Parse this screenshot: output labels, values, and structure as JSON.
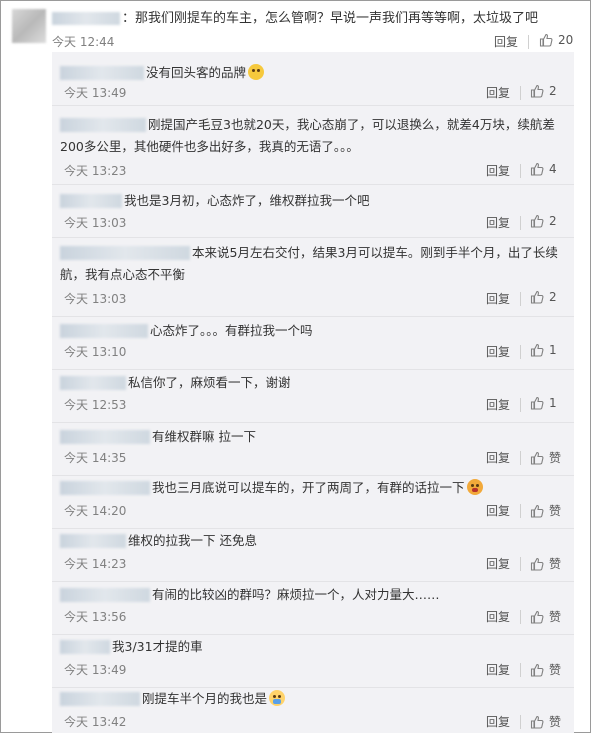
{
  "top": {
    "text": "：那我们刚提车的车主，怎么管啊？早说一声我们再等等啊，太垃圾了吧",
    "time": "今天 12:44",
    "reply_label": "回复",
    "likes": "20"
  },
  "reply_label": "回复",
  "replies": [
    {
      "text": "没有回头客的品牌",
      "time": "今天 13:49",
      "likes": "2",
      "emoji": "smile"
    },
    {
      "text": "刚提国产毛豆3也就20天，我心态崩了，可以退换么，就差4万块，续航差200多公里，其他硬件也多出好多，我真的无语了。。。",
      "time": "今天 13:23",
      "likes": "4",
      "emoji": ""
    },
    {
      "text": "我也是3月初，心态炸了，维权群拉我一个吧",
      "time": "今天 13:03",
      "likes": "2",
      "emoji": ""
    },
    {
      "text": "本来说5月左右交付，结果3月可以提车。刚到手半个月，出了长续航，我有点心态不平衡",
      "time": "今天 13:03",
      "likes": "2",
      "emoji": ""
    },
    {
      "text": "心态炸了。。。有群拉我一个吗",
      "time": "今天 13:10",
      "likes": "1",
      "emoji": ""
    },
    {
      "text": "私信你了，麻烦看一下，谢谢",
      "time": "今天 12:53",
      "likes": "1",
      "emoji": ""
    },
    {
      "text": "有维权群嘛 拉一下",
      "time": "今天 14:35",
      "likes": "赞",
      "emoji": ""
    },
    {
      "text": "我也三月底说可以提车的，开了两周了，有群的话拉一下",
      "time": "今天 14:20",
      "likes": "赞",
      "emoji": "cry"
    },
    {
      "text": "维权的拉我一下 还免息",
      "time": "今天 14:23",
      "likes": "赞",
      "emoji": ""
    },
    {
      "text": "有闹的比较凶的群吗？麻烦拉一个，人对力量大……",
      "time": "今天 13:56",
      "likes": "赞",
      "emoji": ""
    },
    {
      "text": "我3/31才提的車",
      "time": "今天 13:49",
      "likes": "赞",
      "emoji": ""
    },
    {
      "text": "刚提车半个月的我也是",
      "time": "今天 13:42",
      "likes": "赞",
      "emoji": "pray"
    }
  ],
  "colors": {
    "reply_bg": "#f2f2f5",
    "text": "#333333",
    "meta": "#808080"
  }
}
